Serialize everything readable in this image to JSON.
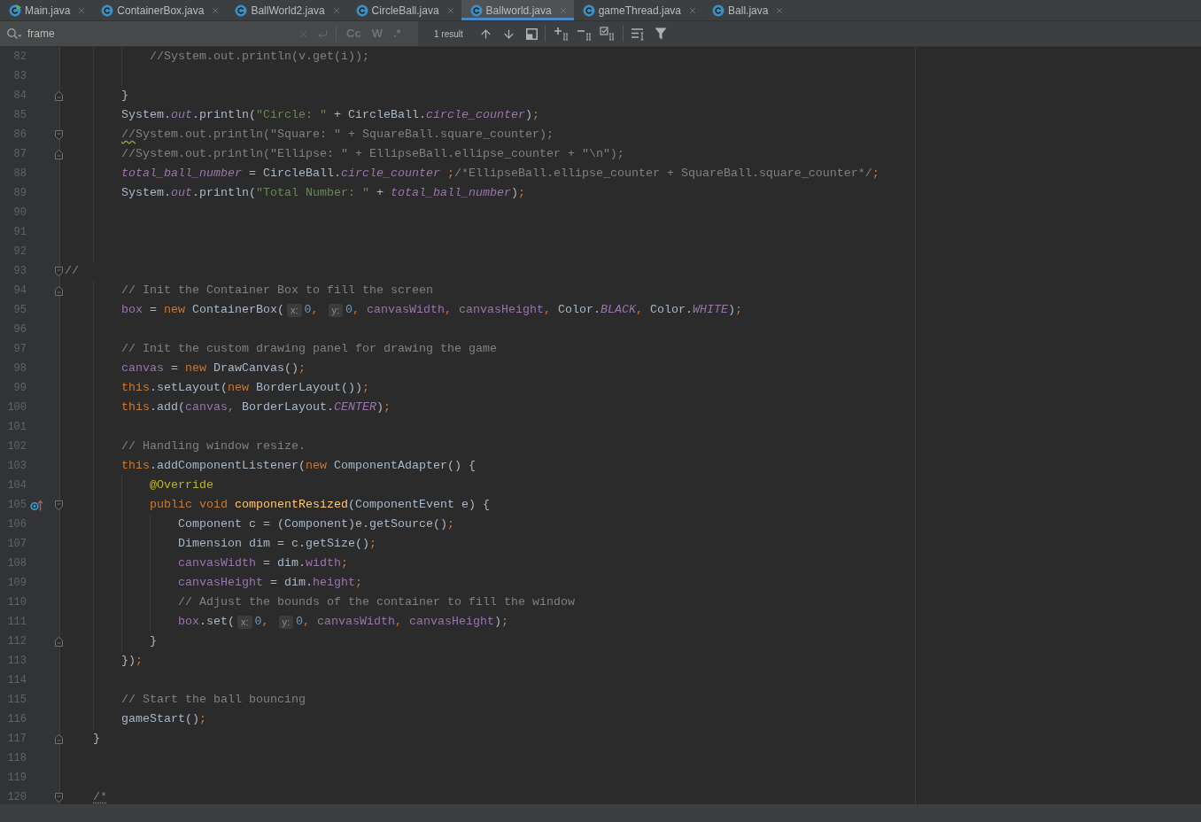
{
  "tabs": [
    {
      "label": "Main.java",
      "kind": "runnable_class",
      "selected": false
    },
    {
      "label": "ContainerBox.java",
      "kind": "class",
      "selected": false
    },
    {
      "label": "BallWorld2.java",
      "kind": "class",
      "selected": false
    },
    {
      "label": "CircleBall.java",
      "kind": "class",
      "selected": false
    },
    {
      "label": "Ballworld.java",
      "kind": "class",
      "selected": true
    },
    {
      "label": "gameThread.java",
      "kind": "class",
      "selected": false
    },
    {
      "label": "Ball.java",
      "kind": "class",
      "selected": false
    }
  ],
  "search": {
    "value": "frame",
    "options": [
      {
        "label": "Cc",
        "selected": false
      },
      {
        "label": "W",
        "selected": false
      },
      {
        "label": ".*",
        "selected": false
      }
    ],
    "result_count": "1 result"
  },
  "editor": {
    "lines": [
      {
        "number": "82",
        "fold_start": false,
        "fold_end": false,
        "override": false,
        "tokens": [
          {
            "kind": "comment",
            "text": "            //System.out.println(v.get(i));"
          }
        ]
      },
      {
        "number": "83",
        "fold_start": false,
        "fold_end": false,
        "override": false
      },
      {
        "number": "84",
        "fold_start": false,
        "fold_end": true,
        "override": false,
        "tokens": [
          {
            "kind": "plain",
            "text": "        }"
          }
        ]
      },
      {
        "number": "85",
        "fold_start": false,
        "fold_end": false,
        "override": false,
        "tokens": [
          {
            "kind": "plain",
            "text": "        System."
          },
          {
            "kind": "static",
            "text": "out"
          },
          {
            "kind": "plain",
            "text": ".println("
          },
          {
            "kind": "string",
            "text": "\"Circle: \""
          },
          {
            "kind": "plain",
            "text": " + CircleBall."
          },
          {
            "kind": "static",
            "text": "circle_counter"
          },
          {
            "kind": "plain",
            "text": ")"
          },
          {
            "kind": "keyword",
            "text": ";"
          }
        ]
      },
      {
        "number": "86",
        "fold_start": true,
        "fold_end": false,
        "override": false,
        "tokens": [
          {
            "kind": "typo",
            "text": "        //"
          },
          {
            "kind": "comment",
            "text": "System.out.println(\"Square: \" + SquareBall.square_counter);"
          }
        ]
      },
      {
        "number": "87",
        "fold_start": false,
        "fold_end": true,
        "override": false,
        "tokens": [
          {
            "kind": "comment",
            "text": "        //System.out.println(\"Ellipse: \" + EllipseBall.ellipse_counter + \"\\n\");"
          }
        ]
      },
      {
        "number": "88",
        "fold_start": false,
        "fold_end": false,
        "override": false,
        "tokens": [
          {
            "kind": "static",
            "text": "        total_ball_number"
          },
          {
            "kind": "plain",
            "text": " = CircleBall."
          },
          {
            "kind": "static",
            "text": "circle_counter"
          },
          {
            "kind": "keyword",
            "text": " ;"
          },
          {
            "kind": "comment",
            "text": "/*EllipseBall.ellipse_counter + SquareBall.square_counter*/"
          },
          {
            "kind": "keyword",
            "text": ";"
          }
        ]
      },
      {
        "number": "89",
        "fold_start": false,
        "fold_end": false,
        "override": false,
        "tokens": [
          {
            "kind": "plain",
            "text": "        System."
          },
          {
            "kind": "static",
            "text": "out"
          },
          {
            "kind": "plain",
            "text": ".println("
          },
          {
            "kind": "string",
            "text": "\"Total Number: \""
          },
          {
            "kind": "plain",
            "text": " + "
          },
          {
            "kind": "static",
            "text": "total_ball_number"
          },
          {
            "kind": "plain",
            "text": ")"
          },
          {
            "kind": "keyword",
            "text": ";"
          }
        ]
      },
      {
        "number": "90",
        "fold_start": false,
        "fold_end": false,
        "override": false
      },
      {
        "number": "91",
        "fold_start": false,
        "fold_end": false,
        "override": false
      },
      {
        "number": "92",
        "fold_start": false,
        "fold_end": false,
        "override": false
      },
      {
        "number": "93",
        "fold_start": true,
        "fold_end": false,
        "override": false,
        "tokens": [
          {
            "kind": "comment",
            "text": "//"
          }
        ]
      },
      {
        "number": "94",
        "fold_start": false,
        "fold_end": true,
        "override": false,
        "tokens": [
          {
            "kind": "comment",
            "text": "        // Init the Container Box to fill the screen"
          }
        ]
      },
      {
        "number": "95",
        "fold_start": false,
        "fold_end": false,
        "override": false,
        "tokens": [
          {
            "kind": "field",
            "text": "        box"
          },
          {
            "kind": "plain",
            "text": " = "
          },
          {
            "kind": "keyword",
            "text": "new"
          },
          {
            "kind": "plain",
            "text": " ContainerBox("
          },
          {
            "kind": "hint",
            "text": "x:"
          },
          {
            "kind": "number",
            "text": "0"
          },
          {
            "kind": "keyword",
            "text": ", "
          },
          {
            "kind": "hint",
            "text": "y:"
          },
          {
            "kind": "number",
            "text": "0"
          },
          {
            "kind": "keyword",
            "text": ", "
          },
          {
            "kind": "field",
            "text": "canvasWidth"
          },
          {
            "kind": "keyword",
            "text": ", "
          },
          {
            "kind": "field",
            "text": "canvasHeight"
          },
          {
            "kind": "keyword",
            "text": ", "
          },
          {
            "kind": "plain",
            "text": "Color."
          },
          {
            "kind": "static",
            "text": "BLACK"
          },
          {
            "kind": "keyword",
            "text": ", "
          },
          {
            "kind": "plain",
            "text": "Color."
          },
          {
            "kind": "static",
            "text": "WHITE"
          },
          {
            "kind": "plain",
            "text": ")"
          },
          {
            "kind": "keyword",
            "text": ";"
          }
        ]
      },
      {
        "number": "96",
        "fold_start": false,
        "fold_end": false,
        "override": false
      },
      {
        "number": "97",
        "fold_start": false,
        "fold_end": false,
        "override": false,
        "tokens": [
          {
            "kind": "comment",
            "text": "        // Init the custom drawing panel for drawing the game"
          }
        ]
      },
      {
        "number": "98",
        "fold_start": false,
        "fold_end": false,
        "override": false,
        "tokens": [
          {
            "kind": "field",
            "text": "        canvas"
          },
          {
            "kind": "plain",
            "text": " = "
          },
          {
            "kind": "keyword",
            "text": "new"
          },
          {
            "kind": "plain",
            "text": " DrawCanvas()"
          },
          {
            "kind": "keyword",
            "text": ";"
          }
        ]
      },
      {
        "number": "99",
        "fold_start": false,
        "fold_end": false,
        "override": false,
        "tokens": [
          {
            "kind": "keyword",
            "text": "        this"
          },
          {
            "kind": "plain",
            "text": ".setLayout("
          },
          {
            "kind": "keyword",
            "text": "new"
          },
          {
            "kind": "plain",
            "text": " BorderLayout())"
          },
          {
            "kind": "keyword",
            "text": ";"
          }
        ]
      },
      {
        "number": "100",
        "fold_start": false,
        "fold_end": false,
        "override": false,
        "tokens": [
          {
            "kind": "keyword",
            "text": "        this"
          },
          {
            "kind": "plain",
            "text": ".add("
          },
          {
            "kind": "field",
            "text": "canvas"
          },
          {
            "kind": "keyword",
            "text": ", "
          },
          {
            "kind": "plain",
            "text": "BorderLayout."
          },
          {
            "kind": "static",
            "text": "CENTER"
          },
          {
            "kind": "plain",
            "text": ")"
          },
          {
            "kind": "keyword",
            "text": ";"
          }
        ]
      },
      {
        "number": "101",
        "fold_start": false,
        "fold_end": false,
        "override": false
      },
      {
        "number": "102",
        "fold_start": false,
        "fold_end": false,
        "override": false,
        "tokens": [
          {
            "kind": "comment",
            "text": "        // Handling window resize."
          }
        ]
      },
      {
        "number": "103",
        "fold_start": false,
        "fold_end": false,
        "override": false,
        "tokens": [
          {
            "kind": "keyword",
            "text": "        this"
          },
          {
            "kind": "plain",
            "text": ".addComponentListener("
          },
          {
            "kind": "keyword",
            "text": "new"
          },
          {
            "kind": "plain",
            "text": " ComponentAdapter() {"
          }
        ]
      },
      {
        "number": "104",
        "fold_start": false,
        "fold_end": false,
        "override": false,
        "tokens": [
          {
            "kind": "annotation",
            "text": "            @Override"
          }
        ]
      },
      {
        "number": "105",
        "fold_start": true,
        "fold_end": false,
        "override": true,
        "tokens": [
          {
            "kind": "keyword",
            "text": "            public void "
          },
          {
            "kind": "method",
            "text": "componentResized"
          },
          {
            "kind": "plain",
            "text": "(ComponentEvent e) {"
          }
        ]
      },
      {
        "number": "106",
        "fold_start": false,
        "fold_end": false,
        "override": false,
        "tokens": [
          {
            "kind": "plain",
            "text": "                Component c = (Component)e.getSource()"
          },
          {
            "kind": "keyword",
            "text": ";"
          }
        ]
      },
      {
        "number": "107",
        "fold_start": false,
        "fold_end": false,
        "override": false,
        "tokens": [
          {
            "kind": "plain",
            "text": "                Dimension dim = c.getSize()"
          },
          {
            "kind": "keyword",
            "text": ";"
          }
        ]
      },
      {
        "number": "108",
        "fold_start": false,
        "fold_end": false,
        "override": false,
        "tokens": [
          {
            "kind": "field",
            "text": "                canvasWidth"
          },
          {
            "kind": "plain",
            "text": " = dim."
          },
          {
            "kind": "field",
            "text": "width"
          },
          {
            "kind": "keyword",
            "text": ";"
          }
        ]
      },
      {
        "number": "109",
        "fold_start": false,
        "fold_end": false,
        "override": false,
        "tokens": [
          {
            "kind": "field",
            "text": "                canvasHeight"
          },
          {
            "kind": "plain",
            "text": " = dim."
          },
          {
            "kind": "field",
            "text": "height"
          },
          {
            "kind": "keyword",
            "text": ";"
          }
        ]
      },
      {
        "number": "110",
        "fold_start": false,
        "fold_end": false,
        "override": false,
        "tokens": [
          {
            "kind": "comment",
            "text": "                // Adjust the bounds of the container to fill the window"
          }
        ]
      },
      {
        "number": "111",
        "fold_start": false,
        "fold_end": false,
        "override": false,
        "tokens": [
          {
            "kind": "field",
            "text": "                box"
          },
          {
            "kind": "plain",
            "text": ".set("
          },
          {
            "kind": "hint",
            "text": "x:"
          },
          {
            "kind": "number",
            "text": "0"
          },
          {
            "kind": "keyword",
            "text": ", "
          },
          {
            "kind": "hint",
            "text": "y:"
          },
          {
            "kind": "number",
            "text": "0"
          },
          {
            "kind": "keyword",
            "text": ", "
          },
          {
            "kind": "field",
            "text": "canvasWidth"
          },
          {
            "kind": "keyword",
            "text": ", "
          },
          {
            "kind": "field",
            "text": "canvasHeight"
          },
          {
            "kind": "plain",
            "text": ")"
          },
          {
            "kind": "keyword",
            "text": ";"
          }
        ]
      },
      {
        "number": "112",
        "fold_start": false,
        "fold_end": true,
        "override": false,
        "tokens": [
          {
            "kind": "plain",
            "text": "            }"
          }
        ]
      },
      {
        "number": "113",
        "fold_start": false,
        "fold_end": false,
        "override": false,
        "tokens": [
          {
            "kind": "plain",
            "text": "        })"
          },
          {
            "kind": "keyword",
            "text": ";"
          }
        ]
      },
      {
        "number": "114",
        "fold_start": false,
        "fold_end": false,
        "override": false
      },
      {
        "number": "115",
        "fold_start": false,
        "fold_end": false,
        "override": false,
        "tokens": [
          {
            "kind": "comment",
            "text": "        // Start the ball bouncing"
          }
        ]
      },
      {
        "number": "116",
        "fold_start": false,
        "fold_end": false,
        "override": false,
        "tokens": [
          {
            "kind": "plain",
            "text": "        gameStart()"
          },
          {
            "kind": "keyword",
            "text": ";"
          }
        ]
      },
      {
        "number": "117",
        "fold_start": false,
        "fold_end": true,
        "override": false,
        "tokens": [
          {
            "kind": "plain",
            "text": "    }"
          }
        ]
      },
      {
        "number": "118",
        "fold_start": false,
        "fold_end": false,
        "override": false
      },
      {
        "number": "119",
        "fold_start": false,
        "fold_end": false,
        "override": false
      },
      {
        "number": "120",
        "fold_start": true,
        "fold_end": false,
        "override": false,
        "tokens": [
          {
            "kind": "weak",
            "text": "    /*"
          }
        ]
      }
    ]
  }
}
